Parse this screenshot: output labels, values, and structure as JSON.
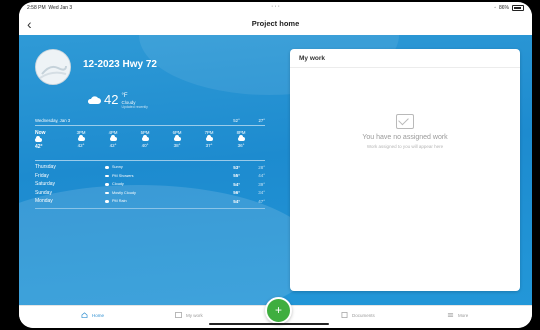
{
  "status": {
    "time": "2:58 PM",
    "date": "Wed Jan 3",
    "battery": "86%"
  },
  "nav": {
    "back_label": "‹",
    "title": "Project home"
  },
  "project": {
    "name": "12-2023 Hwy 72"
  },
  "current_weather": {
    "temp": "42",
    "unit": "°F",
    "condition": "Cloudy",
    "sub": "Updated recently",
    "icon": "cloud-icon"
  },
  "forecast_header": {
    "date": "Wednesday, Jan 3",
    "high": "52°",
    "low": "27°"
  },
  "hourly": [
    {
      "time": "Now",
      "temp": "42°"
    },
    {
      "time": "3PM",
      "temp": "42°"
    },
    {
      "time": "4PM",
      "temp": "42°"
    },
    {
      "time": "5PM",
      "temp": "40°"
    },
    {
      "time": "6PM",
      "temp": "38°"
    },
    {
      "time": "7PM",
      "temp": "37°"
    },
    {
      "time": "8PM",
      "temp": "36°"
    }
  ],
  "daily": [
    {
      "day": "Thursday",
      "condition": "Sunny",
      "high": "53°",
      "low": "28°"
    },
    {
      "day": "Friday",
      "condition": "PM Showers",
      "high": "55°",
      "low": "44°"
    },
    {
      "day": "Saturday",
      "condition": "Cloudy",
      "high": "54°",
      "low": "39°"
    },
    {
      "day": "Sunday",
      "condition": "Mostly Cloudy",
      "high": "56°",
      "low": "34°"
    },
    {
      "day": "Monday",
      "condition": "PM Rain",
      "high": "54°",
      "low": "47°"
    }
  ],
  "my_work": {
    "title": "My work",
    "empty_title": "You have no assigned work",
    "empty_sub": "Work assigned to you will appear here"
  },
  "tabs": {
    "home": "Home",
    "my_work": "My work",
    "add": "+",
    "documents": "Documents",
    "more": "More"
  },
  "colors": {
    "accent": "#2f8fd1",
    "fab": "#3fae3f",
    "weather_bg": "#1d8bcf"
  }
}
